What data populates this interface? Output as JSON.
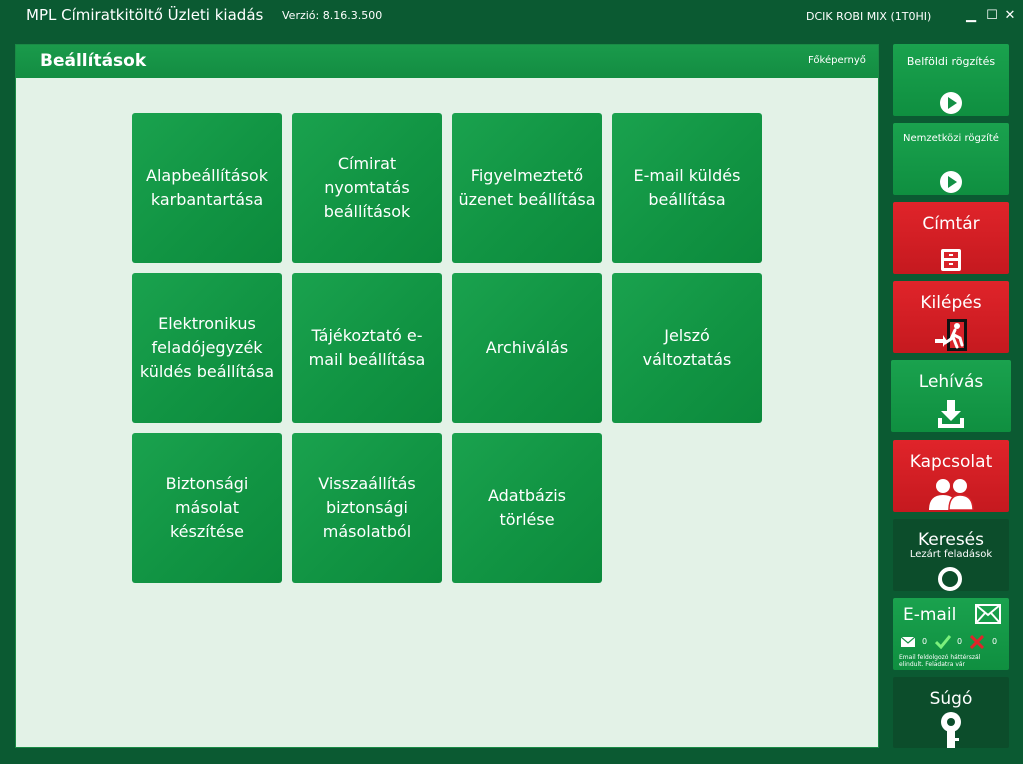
{
  "window": {
    "title": "MPL Címiratkitöltő Üzleti kiadás",
    "version": "Verzió: 8.16.3.500",
    "user": "DCIK ROBI MIX  (1T0HI)",
    "minimize": "▁",
    "maximize": "☐",
    "close": "✕"
  },
  "main": {
    "title": "Beállítások",
    "home_link": "Főképernyő",
    "tiles": [
      "Alapbeállítások karbantartása",
      "Címirat nyomtatás beállítások",
      "Figyelmeztető üzenet beállítása",
      "E-mail küldés beállítása",
      "Elektronikus feladójegyzék küldés beállítása",
      "Tájékoztató e-mail beállítása",
      "Archiválás",
      "Jelszó változtatás",
      "Biztonsági másolat készítése",
      "Visszaállítás biztonsági másolatból",
      "Adatbázis törlése"
    ]
  },
  "sidebar": {
    "domestic": "Belföldi rögzítés",
    "international": "Nemzetközi rögzíté",
    "directory": "Címtár",
    "exit": "Kilépés",
    "retrieve": "Lehívás",
    "contact": "Kapcsolat",
    "search": "Keresés",
    "search_sub": "Lezárt feladások",
    "email": "E-mail",
    "email_counts": [
      "0",
      "0",
      "0"
    ],
    "email_note": "Email feldolgozó háttérszál elindult. Feladatra vár",
    "help": "Súgó"
  },
  "colors": {
    "frame": "#0b5a32",
    "tile_green": "#139045",
    "red": "#d8232a",
    "panel_bg": "#e3f2e7"
  }
}
